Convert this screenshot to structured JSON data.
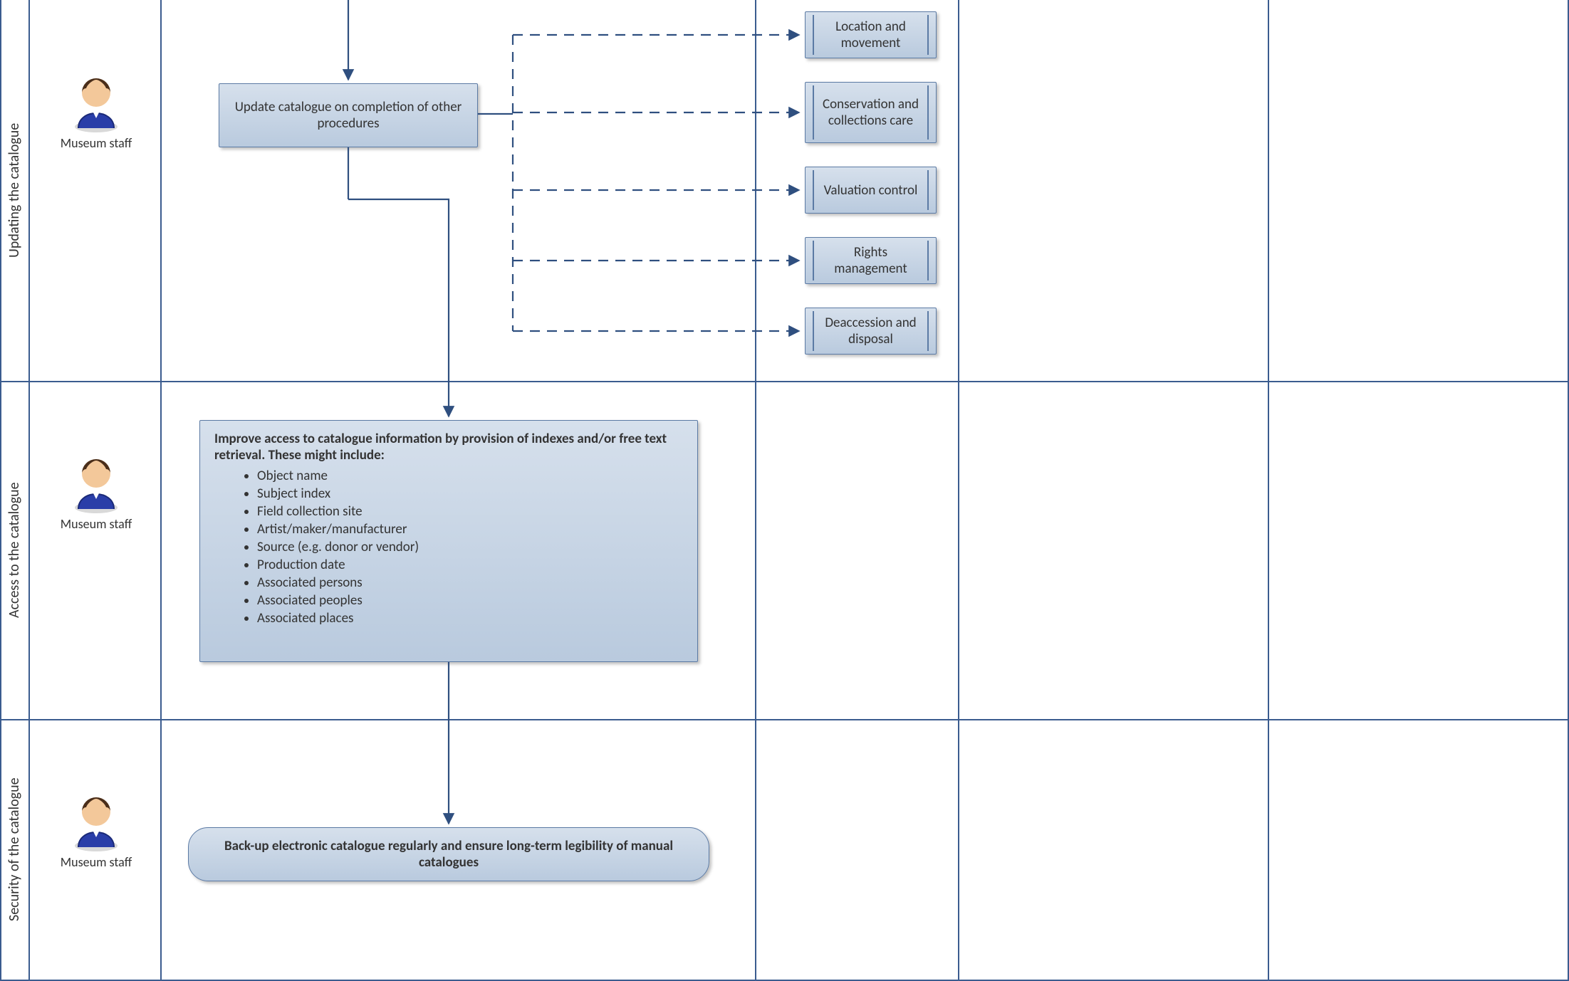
{
  "lanes": {
    "lane1": "Updating the catalogue",
    "lane2": "Access to the catalogue",
    "lane3": "Security of the catalogue"
  },
  "actor": {
    "caption": "Museum staff"
  },
  "boxes": {
    "update_proc": "Update catalogue on completion of other procedures",
    "sub1": "Location and movement",
    "sub2": "Conservation and collections care",
    "sub3": "Valuation control",
    "sub4": "Rights management",
    "sub5": "Deaccession and disposal"
  },
  "infobox": {
    "heading": "Improve access to catalogue information by provision of indexes and/or free text retrieval. These might include:",
    "items": [
      "Object name",
      "Subject index",
      "Field collection site",
      "Artist/maker/manufacturer",
      "Source (e.g. donor or vendor)",
      "Production date",
      "Associated persons",
      "Associated peoples",
      "Associated places"
    ]
  },
  "terminator": "Back-up electronic catalogue regularly and ensure long-term legibility of manual catalogues"
}
